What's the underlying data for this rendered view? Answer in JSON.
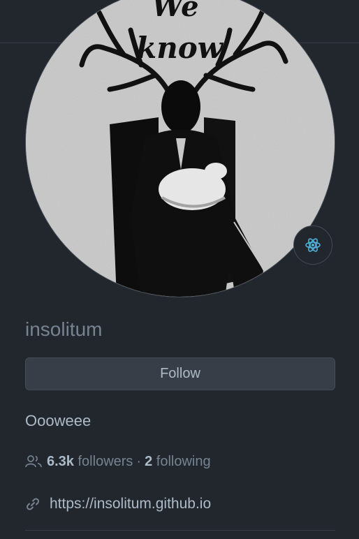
{
  "profile": {
    "avatar_text_line1": "We",
    "avatar_text_line2": "know",
    "status_icon": "atom-icon",
    "username": "insolitum",
    "follow_label": "Follow",
    "bio": "Oooweee",
    "followers_count": "6.3k",
    "followers_label": "followers",
    "separator": "·",
    "following_count": "2",
    "following_label": "following",
    "website": "https://insolitum.github.io"
  },
  "colors": {
    "background": "#22272e",
    "text_primary": "#adbac7",
    "text_muted": "#768390",
    "border": "#444c56",
    "button_bg": "#373e47",
    "status_accent": "#4fb3d9"
  }
}
